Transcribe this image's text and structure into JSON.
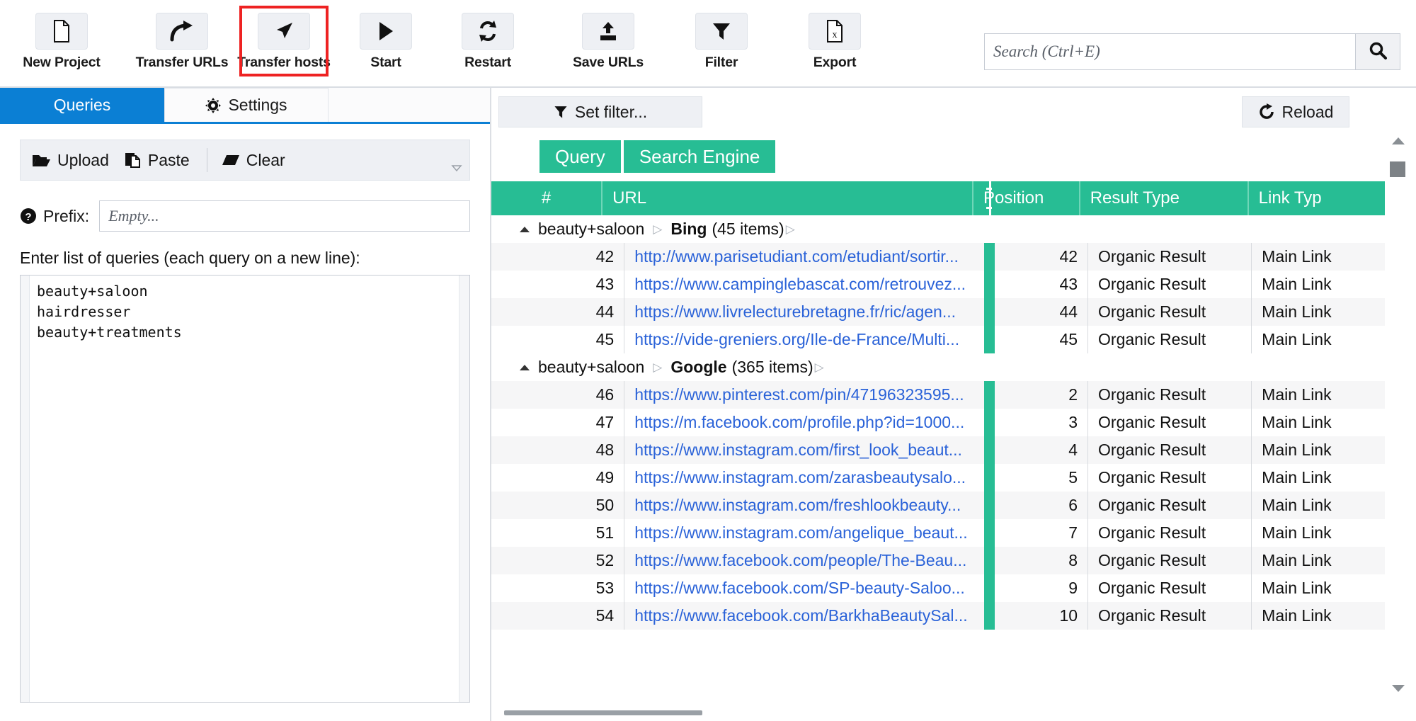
{
  "toolbar": {
    "buttons": [
      {
        "label": "New Project",
        "icon": "file-icon"
      },
      {
        "label": "Transfer URLs",
        "icon": "arrow-curve-right-icon"
      },
      {
        "label": "Transfer hosts",
        "icon": "cursor-arrow-icon",
        "highlighted": true
      },
      {
        "label": "Start",
        "icon": "play-icon"
      },
      {
        "label": "Restart",
        "icon": "refresh-icon"
      },
      {
        "label": "Save URLs",
        "icon": "upload-tray-icon"
      },
      {
        "label": "Filter",
        "icon": "funnel-icon"
      },
      {
        "label": "Export",
        "icon": "excel-file-icon"
      }
    ],
    "highlight_color": "#ee2222"
  },
  "search": {
    "placeholder": "Search (Ctrl+E)",
    "value": "",
    "button_icon": "search-icon"
  },
  "left_panel": {
    "tabs": [
      {
        "label": "Queries",
        "active": true
      },
      {
        "label": "Settings",
        "active": false,
        "icon": "gear-icon"
      }
    ],
    "query_toolbar": [
      {
        "label": "Upload",
        "icon": "folder-open-icon"
      },
      {
        "label": "Paste",
        "icon": "paste-icon"
      },
      {
        "label": "Clear",
        "icon": "eraser-icon"
      }
    ],
    "prefix": {
      "label": "Prefix:",
      "help_icon": "help-circle-icon",
      "placeholder": "Empty...",
      "value": ""
    },
    "queries_hint": "Enter list of queries (each query on a new line):",
    "queries_text": "beauty+saloon\nhairdresser\nbeauty+treatments"
  },
  "right_panel": {
    "set_filter_label": "Set filter...",
    "set_filter_icon": "funnel-icon",
    "reload_label": "Reload",
    "reload_icon": "refresh-cw-icon",
    "group_chips": [
      "Query",
      "Search Engine"
    ],
    "accent_color": "#27bd94",
    "columns": [
      "#",
      "URL",
      "Position",
      "Result Type",
      "Link Type"
    ],
    "link_type_truncated": "Link Typ",
    "groups": [
      {
        "query": "beauty+saloon",
        "engine": "Bing",
        "count": "(45 items)",
        "expanded": true,
        "rows": [
          {
            "index": "42",
            "url": "http://www.parisetudiant.com/etudiant/sortir...",
            "position": "42",
            "result_type": "Organic Result",
            "link_type": "Main Link"
          },
          {
            "index": "43",
            "url": "https://www.campinglebascat.com/retrouvez...",
            "position": "43",
            "result_type": "Organic Result",
            "link_type": "Main Link"
          },
          {
            "index": "44",
            "url": "https://www.livrelecturebretagne.fr/ric/agen...",
            "position": "44",
            "result_type": "Organic Result",
            "link_type": "Main Link"
          },
          {
            "index": "45",
            "url": "https://vide-greniers.org/Ile-de-France/Multi...",
            "position": "45",
            "result_type": "Organic Result",
            "link_type": "Main Link"
          }
        ]
      },
      {
        "query": "beauty+saloon",
        "engine": "Google",
        "count": "(365 items)",
        "expanded": true,
        "rows": [
          {
            "index": "46",
            "url": "https://www.pinterest.com/pin/47196323595...",
            "position": "2",
            "result_type": "Organic Result",
            "link_type": "Main Link"
          },
          {
            "index": "47",
            "url": "https://m.facebook.com/profile.php?id=1000...",
            "position": "3",
            "result_type": "Organic Result",
            "link_type": "Main Link"
          },
          {
            "index": "48",
            "url": "https://www.instagram.com/first_look_beaut...",
            "position": "4",
            "result_type": "Organic Result",
            "link_type": "Main Link"
          },
          {
            "index": "49",
            "url": "https://www.instagram.com/zarasbeautysalo...",
            "position": "5",
            "result_type": "Organic Result",
            "link_type": "Main Link"
          },
          {
            "index": "50",
            "url": "https://www.instagram.com/freshlookbeauty...",
            "position": "6",
            "result_type": "Organic Result",
            "link_type": "Main Link"
          },
          {
            "index": "51",
            "url": "https://www.instagram.com/angelique_beaut...",
            "position": "7",
            "result_type": "Organic Result",
            "link_type": "Main Link"
          },
          {
            "index": "52",
            "url": "https://www.facebook.com/people/The-Beau...",
            "position": "8",
            "result_type": "Organic Result",
            "link_type": "Main Link"
          },
          {
            "index": "53",
            "url": "https://www.facebook.com/SP-beauty-Saloo...",
            "position": "9",
            "result_type": "Organic Result",
            "link_type": "Main Link"
          },
          {
            "index": "54",
            "url": "https://www.facebook.com/BarkhaBeautySal...",
            "position": "10",
            "result_type": "Organic Result",
            "link_type": "Main Link"
          }
        ]
      }
    ]
  }
}
